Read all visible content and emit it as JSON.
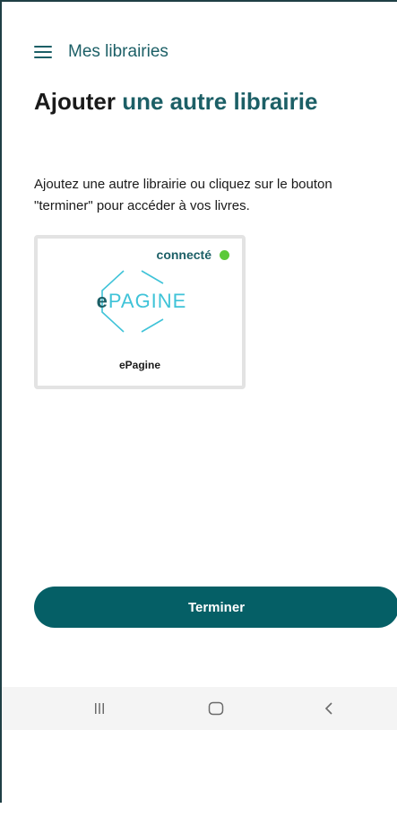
{
  "header": {
    "menu_icon": "hamburger-menu-icon",
    "title": "Mes librairies"
  },
  "page": {
    "title_part1": "Ajouter ",
    "title_part2": "une autre librairie",
    "intro": "Ajoutez une autre librairie ou cliquez sur le bouton \"terminer\" pour accéder à vos livres."
  },
  "libraries": [
    {
      "status": "connecté",
      "status_color": "#5cc93a",
      "logo_prefix": "e",
      "logo_main": "PAGINE",
      "name": "ePagine"
    }
  ],
  "actions": {
    "finish_label": "Terminer"
  },
  "system_nav": {
    "recents_icon": "recents-icon",
    "home_icon": "home-icon",
    "back_icon": "back-icon"
  },
  "colors": {
    "primary": "#055f66",
    "accent_text": "#1c5f66",
    "logo_cyan": "#3fc3d8",
    "connected": "#5cc93a"
  }
}
